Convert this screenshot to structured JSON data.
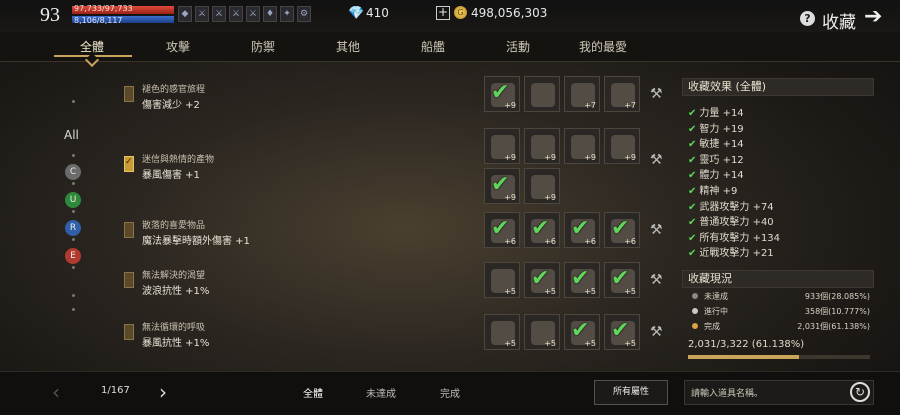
{
  "topbar": {
    "level": "93",
    "hp_text": "97,733/97,733",
    "hp_fraction": 1.0,
    "mp_text": "8,106/8,117",
    "mp_fraction": 0.998,
    "buffs": [
      "◆",
      "⚔",
      "⚔",
      "⚔",
      "⚔",
      "♦",
      "✦",
      "⚙"
    ],
    "gems": "410",
    "gold": "498,056,303",
    "title": "收藏"
  },
  "tabs": [
    "全體",
    "攻擊",
    "防禦",
    "其他",
    "船艦",
    "活動",
    "我的最愛"
  ],
  "filters": {
    "all_label": "All",
    "grades": [
      {
        "label": "C",
        "color": "#6b6b6b"
      },
      {
        "label": "U",
        "color": "#2e8a3a"
      },
      {
        "label": "R",
        "color": "#2f5fa8"
      },
      {
        "label": "E",
        "color": "#b03a2e"
      }
    ]
  },
  "rows": [
    {
      "name": "褪色的感官旅程",
      "effect": "傷害減少 +2",
      "checked": false,
      "slots": [
        {
          "done": true,
          "lv": "+9"
        },
        {
          "done": false,
          "lv": ""
        },
        {
          "done": false,
          "lv": "+7"
        },
        {
          "done": false,
          "lv": "+7"
        }
      ]
    },
    {
      "name": "迷信與熱情的產物",
      "effect": "暴風傷害 +1",
      "checked": true,
      "slots": [
        {
          "done": false,
          "lv": "+9"
        },
        {
          "done": false,
          "lv": "+9"
        },
        {
          "done": false,
          "lv": "+9"
        },
        {
          "done": false,
          "lv": "+9"
        },
        {
          "done": true,
          "lv": "+9"
        },
        {
          "done": false,
          "lv": "+9"
        }
      ]
    },
    {
      "name": "散落的喜愛物品",
      "effect": "魔法暴擊時額外傷害 +1",
      "checked": false,
      "slots": [
        {
          "done": true,
          "lv": "+6"
        },
        {
          "done": true,
          "lv": "+6"
        },
        {
          "done": true,
          "lv": "+6"
        },
        {
          "done": true,
          "lv": "+6"
        }
      ]
    },
    {
      "name": "無法解決的渴望",
      "effect": "波浪抗性 +1%",
      "checked": false,
      "slots": [
        {
          "done": false,
          "lv": "+5"
        },
        {
          "done": true,
          "lv": "+5"
        },
        {
          "done": true,
          "lv": "+5"
        },
        {
          "done": true,
          "lv": "+5"
        }
      ]
    },
    {
      "name": "無法循環的呼吸",
      "effect": "暴風抗性 +1%",
      "checked": false,
      "slots": [
        {
          "done": false,
          "lv": "+5"
        },
        {
          "done": false,
          "lv": "+5"
        },
        {
          "done": true,
          "lv": "+5"
        },
        {
          "done": true,
          "lv": "+5"
        }
      ]
    }
  ],
  "panel": {
    "effects_title": "收藏效果 (全體)",
    "effects": [
      "力量 +14",
      "智力 +19",
      "敏捷 +14",
      "靈巧 +12",
      "體力 +14",
      "精神 +9",
      "武器攻擊力 +74",
      "普通攻擊力 +40",
      "所有攻擊力 +134",
      "近戰攻擊力 +21"
    ],
    "status_title": "收藏現況",
    "status": [
      {
        "label": "未達成",
        "value": "933個(28.085%)",
        "color": "#8a8a8a"
      },
      {
        "label": "進行中",
        "value": "358個(10.777%)",
        "color": "#c8c8c8"
      },
      {
        "label": "完成",
        "value": "2,031個(61.138%)",
        "color": "#d9a441"
      }
    ],
    "total": "2,031/3,322 (61.138%)",
    "total_fraction": 0.61138
  },
  "bottom": {
    "page": "1/167",
    "filter_tabs": [
      "全體",
      "未達成",
      "完成"
    ],
    "all_props": "所有屬性",
    "search_placeholder": "請輸入道具名稱。"
  }
}
